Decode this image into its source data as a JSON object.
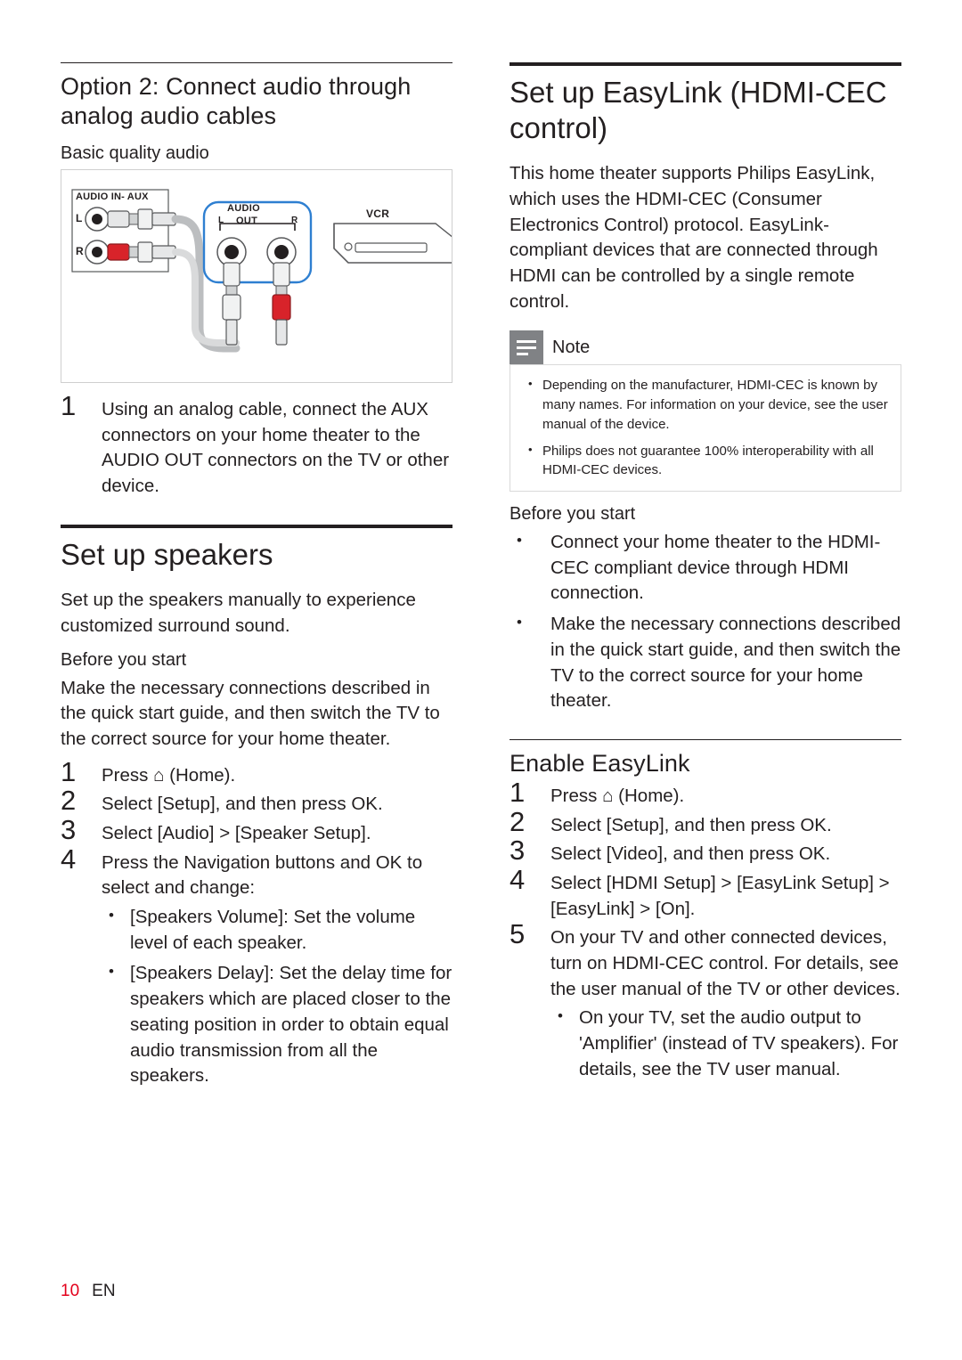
{
  "page": {
    "number": "10",
    "lang": "EN"
  },
  "left": {
    "section_title": "Option 2: Connect audio through analog audio cables",
    "subtitle": "Basic quality audio",
    "figure": {
      "label_audio_in": "AUDIO IN- AUX",
      "label_l": "L",
      "label_r": "R",
      "label_audio_out": "AUDIO",
      "label_out": "OUT",
      "label_out_l": "L",
      "label_out_r": "R",
      "label_vcr": "VCR"
    },
    "step1": "Using an analog cable, connect the AUX connectors on your home theater to the AUDIO OUT connectors on the TV or other device.",
    "step1_num": "1",
    "speakers_title": "Set up speakers",
    "speakers_intro": "Set up the speakers manually to experience customized surround sound.",
    "before_you_start": "Before you start",
    "before_text": "Make the necessary connections described in the quick start guide, and then switch the TV to the correct source for your home theater.",
    "steps": [
      {
        "num": "1",
        "text": "Press ⌂ (Home)."
      },
      {
        "num": "2",
        "text": "Select [Setup], and then press OK."
      },
      {
        "num": "3",
        "text": "Select [Audio] > [Speaker Setup]."
      },
      {
        "num": "4",
        "text": "Press the Navigation buttons and OK to select and change:"
      }
    ],
    "bullets": [
      "[Speakers Volume]: Set the volume level of each speaker.",
      "[Speakers Delay]: Set the delay time for speakers which are placed closer to the seating position in order to obtain equal audio transmission from all the speakers."
    ]
  },
  "right": {
    "title": "Set up EasyLink (HDMI-CEC control)",
    "intro": "This home theater supports Philips EasyLink, which uses the HDMI-CEC (Consumer Electronics Control) protocol. EasyLink-compliant devices that are connected through HDMI can be controlled by a single remote control.",
    "note": {
      "label": "Note",
      "items": [
        "Depending on the manufacturer, HDMI-CEC is known by many names. For information on your device, see the user manual of the device.",
        "Philips does not guarantee 100% interoperability with all HDMI-CEC devices."
      ]
    },
    "before_you_start": "Before you start",
    "before_bullets": [
      "Connect your home theater to the HDMI-CEC compliant device through HDMI connection.",
      "Make the necessary connections described in the quick start guide, and then switch the TV to the correct source for your home theater."
    ],
    "enable_title": "Enable EasyLink",
    "steps": [
      {
        "num": "1",
        "text": "Press ⌂ (Home)."
      },
      {
        "num": "2",
        "text": "Select [Setup], and then press OK."
      },
      {
        "num": "3",
        "text": "Select [Video], and then press OK."
      },
      {
        "num": "4",
        "text": "Select [HDMI Setup] > [EasyLink Setup] > [EasyLink] > [On]."
      },
      {
        "num": "5",
        "text": "On your TV and other connected devices, turn on HDMI-CEC control. For details, see the user manual of the TV or other devices."
      }
    ],
    "sub_bullet": "On your TV, set the audio output to 'Amplifier' (instead of TV speakers). For details, see the TV user manual."
  },
  "colors": {
    "text": "#231f20",
    "accent_red": "#e3001b",
    "note_gray": "#808285",
    "cable_blue": "#2e7fd1"
  }
}
